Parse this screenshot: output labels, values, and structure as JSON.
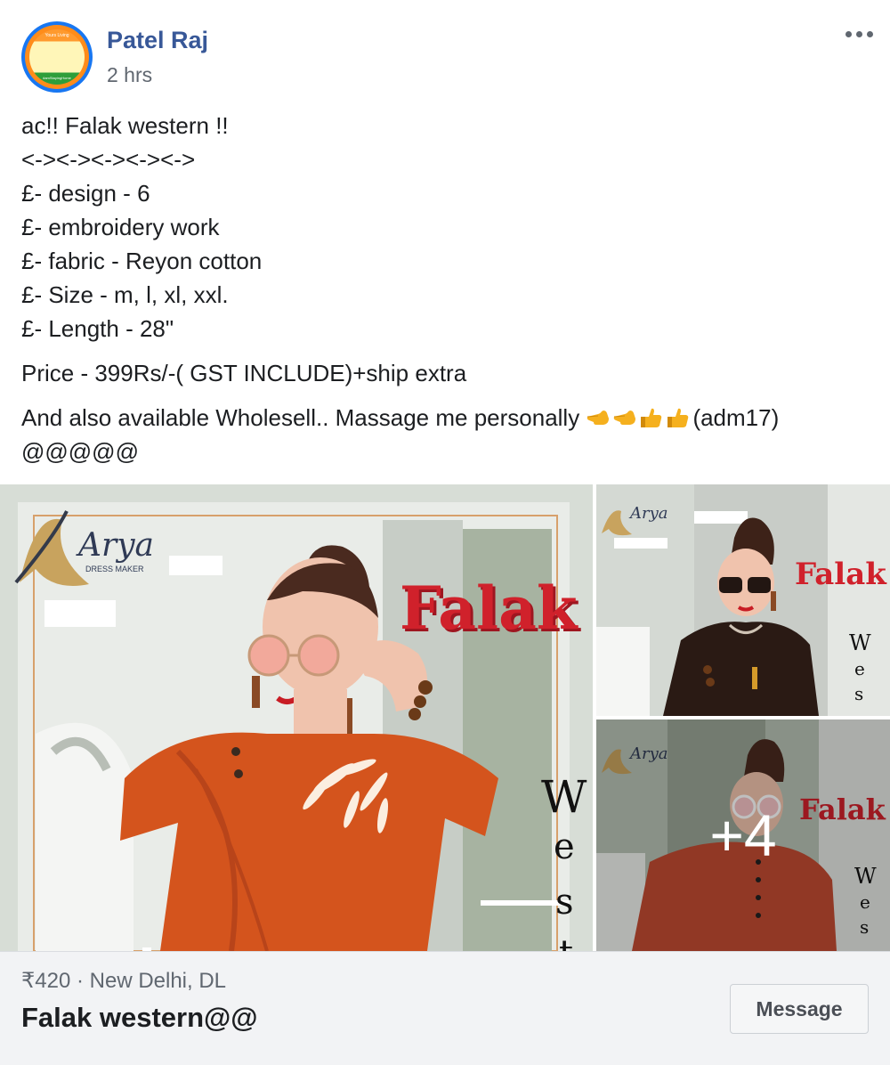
{
  "post": {
    "author": "Patel Raj",
    "time": "2 hrs",
    "avatar": {
      "top_text": "Yours Living",
      "bottom_text": "#amStayingHome"
    },
    "body_lines": [
      "ac!! Falak western !!",
      "<-><-><-><-><->",
      "£- design - 6",
      "£- embroidery work",
      "£- fabric - Reyon cotton",
      "£- Size - m, l, xl, xxl.",
      "£- Length - 28\""
    ],
    "price_line": "Price - 399Rs/-( GST INCLUDE)+ship extra",
    "wholesale_prefix": "And also available Wholesell.. Massage me personally ",
    "wholesale_emojis": [
      "point-left-emoji",
      "point-left-emoji",
      "thumbs-up-emoji",
      "thumbs-up-emoji"
    ],
    "wholesale_suffix": "(adm17)",
    "closing_line": "@@@@@"
  },
  "gallery": {
    "brand": "Arya",
    "brand_sub": "DRESS MAKER",
    "product_word": "Falak",
    "side_word_main": [
      "W",
      "e",
      "s",
      "t"
    ],
    "side_word_small": [
      "W",
      "e",
      "s"
    ],
    "more_count": "+4"
  },
  "listing": {
    "meta": "₹420 · New Delhi, DL",
    "title": "Falak western@@",
    "message_button": "Message"
  },
  "colors": {
    "author_link": "#385898",
    "footer_bg": "#f2f3f5",
    "falak_red": "#d0212b",
    "dress_orange": "#d4541d",
    "dress_black": "#2a1a14",
    "dress_rust": "#c24b32"
  }
}
